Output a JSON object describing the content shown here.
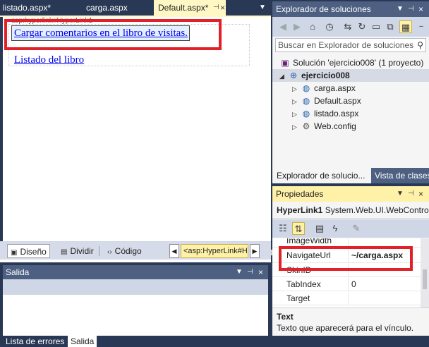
{
  "document_tabs": {
    "listado": "listado.aspx*",
    "carga": "carga.aspx",
    "default": "Default.aspx*"
  },
  "design": {
    "control_tag": "asp:hyperlink#HyperLink1",
    "link_carga": "Cargar comentarios en el libro de visitas.",
    "link_listado": "Listado del libro"
  },
  "view_bar": {
    "diseno": "Diseño",
    "dividir": "Dividir",
    "codigo": "Código",
    "tag_selector": "<asp:HyperLink#H"
  },
  "salida": {
    "title": "Salida"
  },
  "bottom_tabs": {
    "errores": "Lista de errores",
    "salida": "Salida"
  },
  "solution_explorer": {
    "title": "Explorador de soluciones",
    "search_placeholder": "Buscar en Explorador de soluciones",
    "solution": "Solución 'ejercicio008' (1 proyecto)",
    "project": "ejercicio008",
    "files": [
      "carga.aspx",
      "Default.aspx",
      "listado.aspx",
      "Web.config"
    ],
    "tab_explorer": "Explorador de solucio...",
    "tab_classes": "Vista de clases"
  },
  "properties": {
    "title": "Propiedades",
    "object_name": "HyperLink1",
    "object_type": "System.Web.UI.WebControls.HyperLink",
    "rows": [
      {
        "name": "ImageWidth",
        "value": ""
      },
      {
        "name": "NavigateUrl",
        "value": "~/carga.aspx"
      },
      {
        "name": "SkinID",
        "value": ""
      },
      {
        "name": "TabIndex",
        "value": "0"
      },
      {
        "name": "Target",
        "value": ""
      }
    ],
    "description_title": "Text",
    "description_text": "Texto que aparecerá para el vínculo."
  },
  "colors": {
    "ide_dark": "#293955",
    "panel_header": "#4d6082",
    "active_yellow": "#fff1a8",
    "highlight_red": "#e2202a",
    "link_blue": "#0000ee"
  }
}
